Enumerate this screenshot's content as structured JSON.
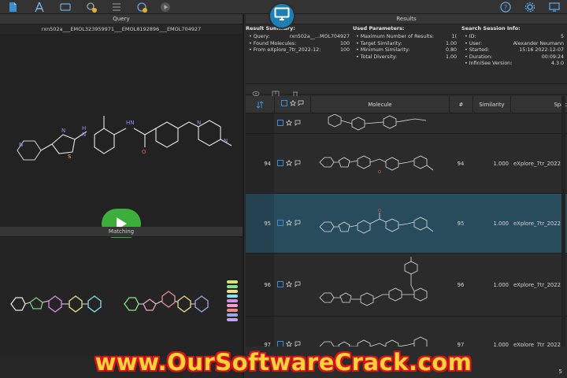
{
  "toolbar": {
    "left_icons": [
      "document-icon",
      "atom-icon",
      "structure-icon",
      "search-badge-icon",
      "list-icon",
      "history-icon",
      "play-small-icon"
    ],
    "right_icons": [
      "help-icon",
      "gear-icon",
      "monitor-icon"
    ]
  },
  "query": {
    "title": "Query",
    "ids": "rxn502a___EMOL323959971___EMOL8192896___EMOL704927"
  },
  "matching": {
    "title": "Matching"
  },
  "results": {
    "title": "Results",
    "summary": {
      "heading": "Result Summary:",
      "rows": [
        {
          "k": "Query:",
          "v": "rxn502a__...MOL704927"
        },
        {
          "k": "Found Molecules:",
          "v": "100"
        },
        {
          "k": "From eXplore_7tr_2022-12:",
          "v": "100"
        }
      ]
    },
    "params": {
      "heading": "Used Parameters:",
      "rows": [
        {
          "k": "Maximum Number of Results:",
          "v": "1("
        },
        {
          "k": "Target Similarity:",
          "v": "1.00"
        },
        {
          "k": "Minimum Similarity:",
          "v": "0.80"
        },
        {
          "k": "Total Diversity:",
          "v": "1.00"
        }
      ]
    },
    "session": {
      "heading": "Search Session Info:",
      "rows": [
        {
          "k": "ID:",
          "v": "5"
        },
        {
          "k": "User:",
          "v": "Alexander Neumann"
        },
        {
          "k": "Started:",
          "v": "15:16 2022-12-07"
        },
        {
          "k": "Duration:",
          "v": "00:09:24"
        },
        {
          "k": "InfiniSee Version:",
          "v": "4.3.0"
        }
      ]
    }
  },
  "table": {
    "columns": {
      "molecule": "Molecule",
      "num": "#",
      "similarity": "Similarity",
      "space": "Spac"
    },
    "rows": [
      {
        "row": "",
        "num": "",
        "similarity": "",
        "space": ""
      },
      {
        "row": "94",
        "num": "94",
        "similarity": "1.000",
        "space": "eXplore_7tr_2022"
      },
      {
        "row": "95",
        "num": "95",
        "similarity": "1.000",
        "space": "eXplore_7tr_2022"
      },
      {
        "row": "96",
        "num": "96",
        "similarity": "1.000",
        "space": "eXplore_7tr_2022"
      },
      {
        "row": "97",
        "num": "97",
        "similarity": "1.000",
        "space": "eXplore_7tr_2022"
      }
    ]
  },
  "status": {
    "counter": "5"
  },
  "watermark": "www.OurSoftwareCrack.com",
  "colors": {
    "accent": "#1e7fb5",
    "play": "#3cae3c",
    "selected_row": "#294c5c",
    "watermark_fill": "#ffd23a",
    "watermark_stroke": "#d8121b"
  }
}
